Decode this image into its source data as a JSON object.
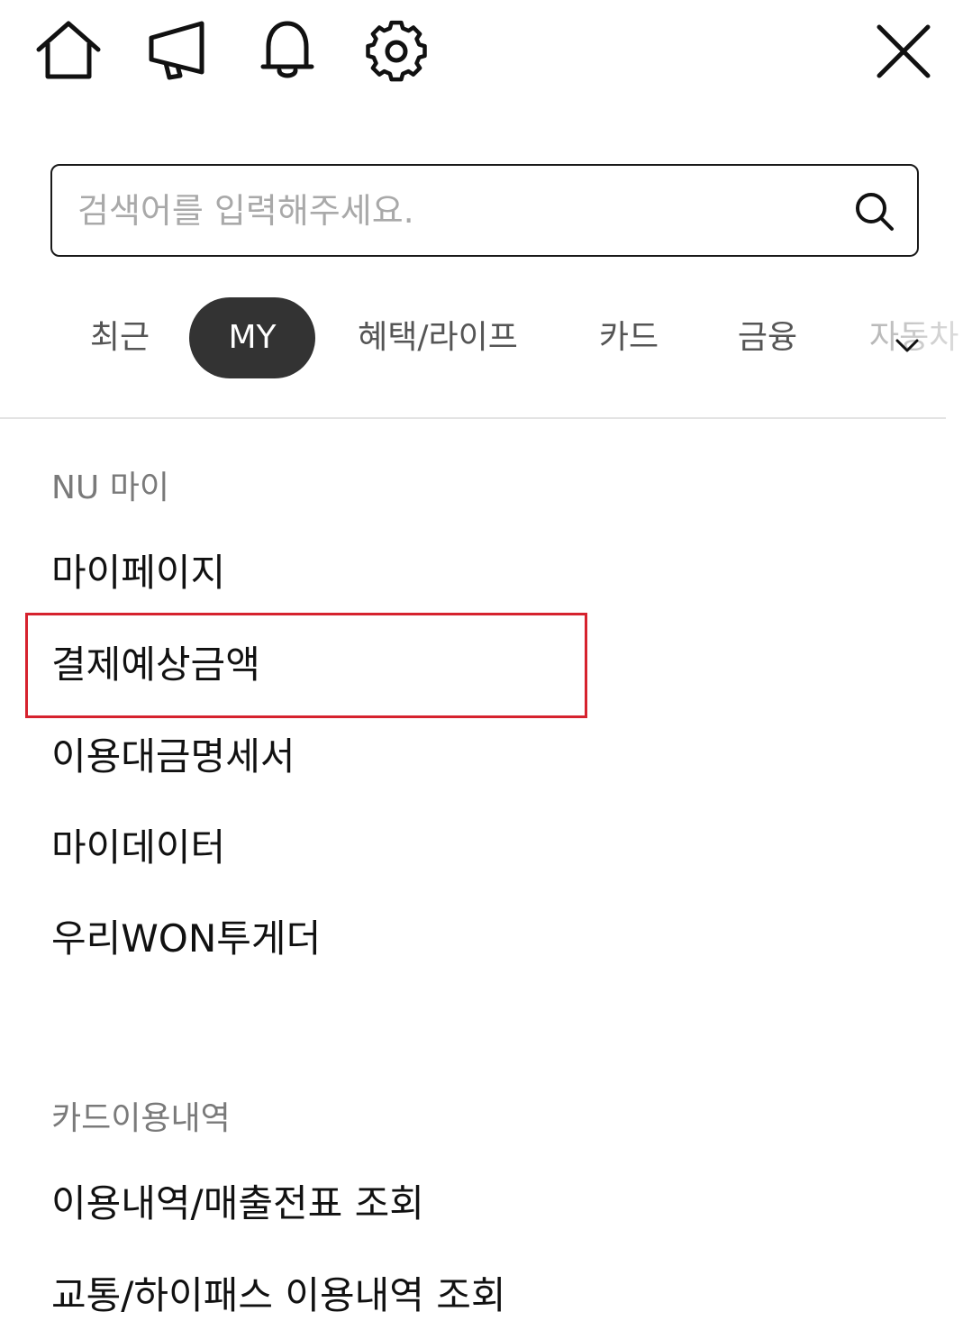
{
  "topbar": {
    "icons": [
      "home-icon",
      "megaphone-icon",
      "bell-icon",
      "gear-icon",
      "close-icon"
    ]
  },
  "search": {
    "placeholder": "검색어를 입력해주세요.",
    "value": ""
  },
  "tabs": [
    {
      "label": "최근",
      "active": false
    },
    {
      "label": "MY",
      "active": true
    },
    {
      "label": "혜택/라이프",
      "active": false
    },
    {
      "label": "카드",
      "active": false
    },
    {
      "label": "금융",
      "active": false
    },
    {
      "label": "자동차",
      "active": false
    }
  ],
  "sections": [
    {
      "title": "NU 마이",
      "items": [
        {
          "label": "마이페이지"
        },
        {
          "label": "결제예상금액",
          "highlighted": true
        },
        {
          "label": "이용대금명세서"
        },
        {
          "label": "마이데이터"
        },
        {
          "label": "우리WON투게더"
        }
      ]
    },
    {
      "title": "카드이용내역",
      "items": [
        {
          "label": "이용내역/매출전표 조회"
        },
        {
          "label": "교통/하이패스 이용내역 조회"
        }
      ]
    }
  ],
  "colors": {
    "active_tab_bg": "#333333",
    "highlight_border": "#d6222e",
    "section_title": "#7a7a7a"
  }
}
